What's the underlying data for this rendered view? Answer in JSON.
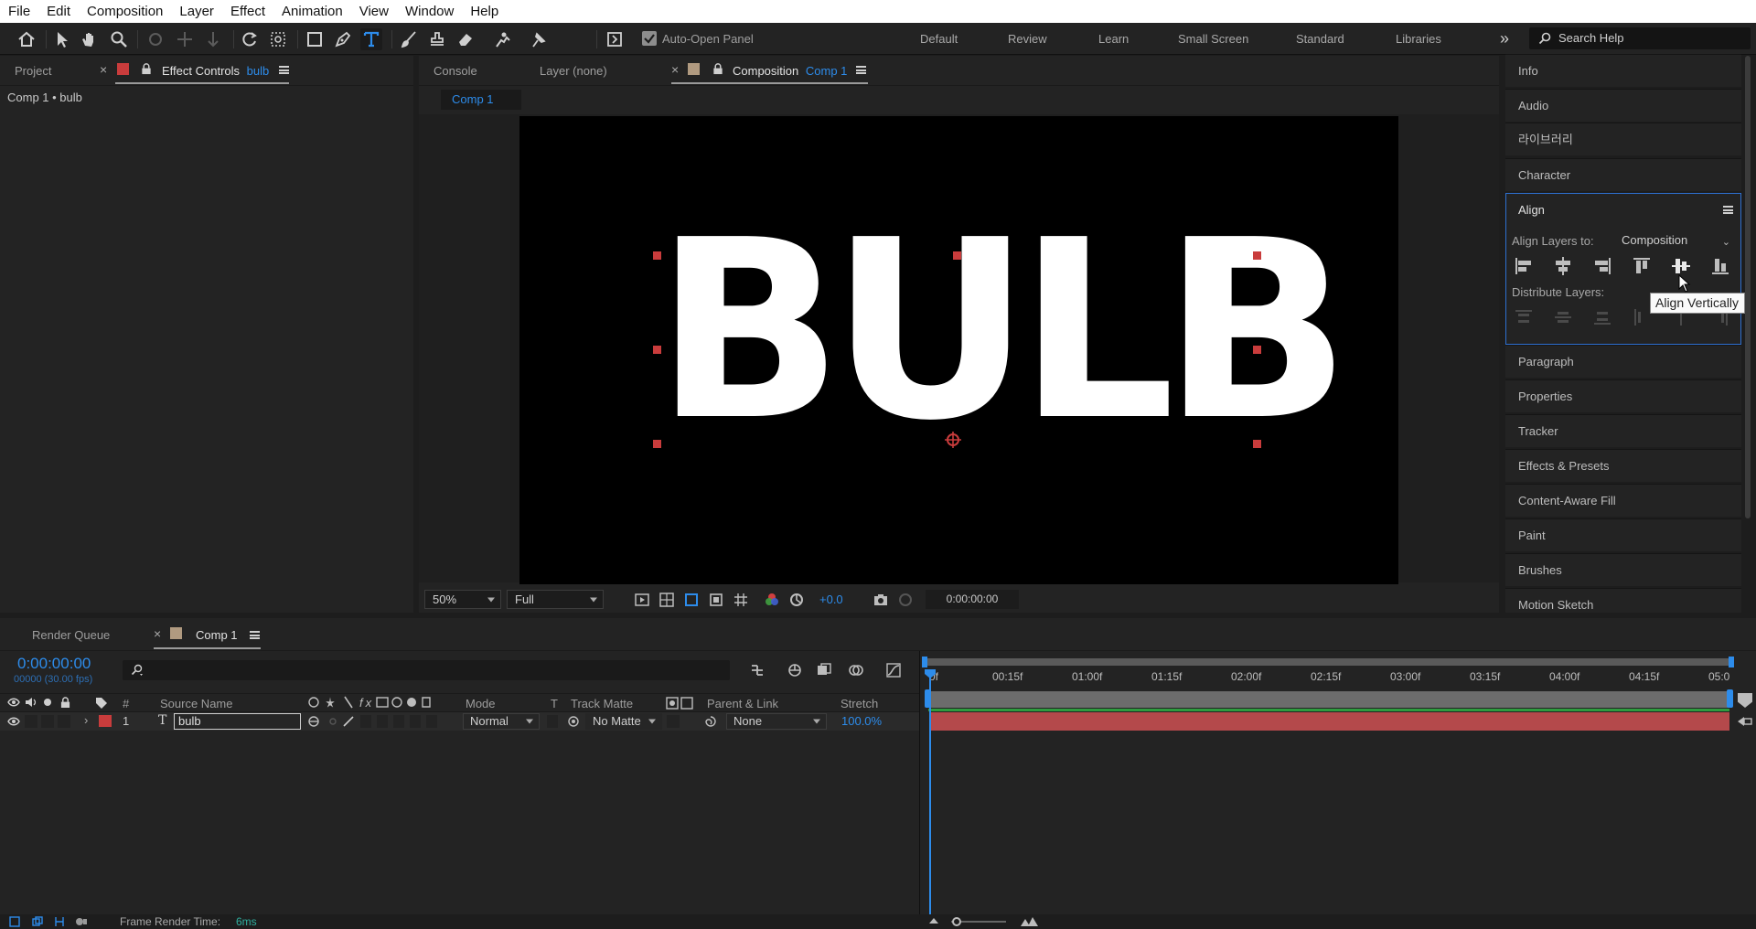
{
  "menu": [
    "File",
    "Edit",
    "Composition",
    "Layer",
    "Effect",
    "Animation",
    "View",
    "Window",
    "Help"
  ],
  "toolbar": {
    "auto_open_panel": "Auto-Open Panel",
    "workspaces": [
      "Default",
      "Review",
      "Learn",
      "Small Screen",
      "Standard",
      "Libraries"
    ],
    "overflow": "»",
    "search_help": "Search Help"
  },
  "left_panel": {
    "tabs": [
      "Project",
      "Effect Controls"
    ],
    "effect_layer": "bulb",
    "breadcrumb": "Comp 1 • bulb"
  },
  "viewer": {
    "tabs": [
      "Console",
      "Layer (none)",
      "Composition"
    ],
    "comp_name": "Comp 1",
    "subtab": "Comp 1",
    "text": "BULB",
    "zoom": "50%",
    "resolution": "Full",
    "exposure": "+0.0",
    "timecode": "0:00:00:00"
  },
  "right_panels": {
    "items_top": [
      "Info",
      "Audio",
      "라이브러리",
      "Character"
    ],
    "align": {
      "title": "Align",
      "align_layers_to_label": "Align Layers to:",
      "align_layers_to_value": "Composition",
      "distribute_label": "Distribute Layers:",
      "tooltip": "Align Vertically"
    },
    "items_bottom": [
      "Paragraph",
      "Properties",
      "Tracker",
      "Effects & Presets",
      "Content-Aware Fill",
      "Paint",
      "Brushes",
      "Motion Sketch"
    ]
  },
  "timeline": {
    "tabs": [
      "Render Queue",
      "Comp 1"
    ],
    "timecode": "0:00:00:00",
    "fps": "00000 (30.00 fps)",
    "search_placeholder": "",
    "headers": {
      "hash": "#",
      "source_name": "Source Name",
      "mode": "Mode",
      "t": "T",
      "track_matte": "Track Matte",
      "parent_link": "Parent & Link",
      "stretch": "Stretch"
    },
    "layer": {
      "index": "1",
      "type_icon": "T",
      "name": "bulb",
      "mode": "Normal",
      "track_matte": "No Matte",
      "parent": "None",
      "stretch": "100.0%"
    },
    "ruler": [
      "0f",
      "00:15f",
      "01:00f",
      "01:15f",
      "02:00f",
      "02:15f",
      "03:00f",
      "03:15f",
      "04:00f",
      "04:15f",
      "05:0"
    ],
    "footer_label": "Frame Render Time:",
    "footer_value": "6ms"
  },
  "colors": {
    "accent_blue": "#2d8ceb",
    "label_red": "#c93c3c",
    "layer_bar": "#b4494b",
    "comp_swatch": "#b09a80"
  }
}
